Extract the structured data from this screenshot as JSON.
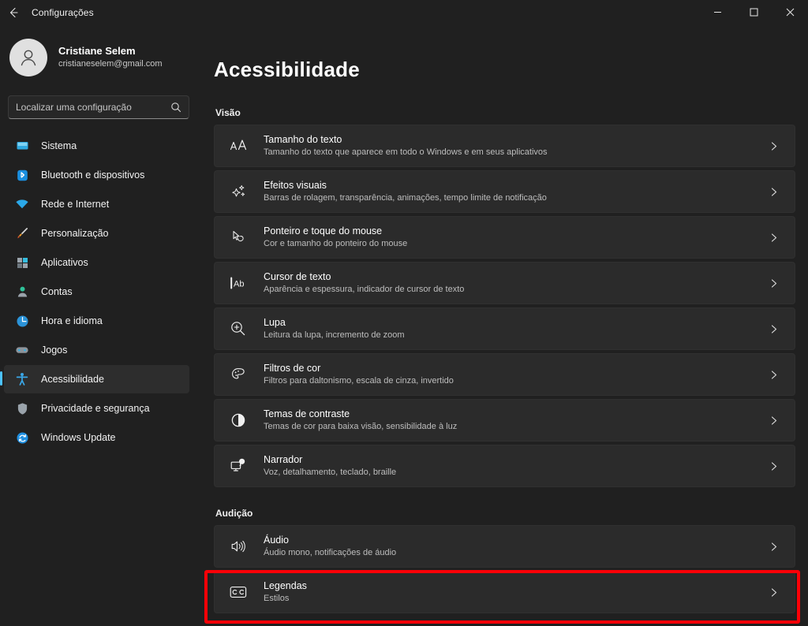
{
  "titlebar": {
    "back_icon": "back-arrow-icon",
    "title": "Configurações",
    "minimize": "–",
    "maximize": "□",
    "close": "✕"
  },
  "sidebar": {
    "account": {
      "name": "Cristiane Selem",
      "email": "cristianeselem@gmail.com",
      "avatar_icon": "person-avatar-icon"
    },
    "search": {
      "placeholder": "Localizar uma configuração",
      "value": "",
      "icon": "search-icon"
    },
    "items": [
      {
        "label": "Sistema",
        "icon": "monitor-icon",
        "active": false
      },
      {
        "label": "Bluetooth e dispositivos",
        "icon": "bluetooth-icon",
        "active": false
      },
      {
        "label": "Rede e Internet",
        "icon": "wifi-icon",
        "active": false
      },
      {
        "label": "Personalização",
        "icon": "paintbrush-icon",
        "active": false
      },
      {
        "label": "Aplicativos",
        "icon": "apps-grid-icon",
        "active": false
      },
      {
        "label": "Contas",
        "icon": "person-icon",
        "active": false
      },
      {
        "label": "Hora e idioma",
        "icon": "clock-icon",
        "active": false
      },
      {
        "label": "Jogos",
        "icon": "gamepad-icon",
        "active": false
      },
      {
        "label": "Acessibilidade",
        "icon": "accessibility-icon",
        "active": true
      },
      {
        "label": "Privacidade e segurança",
        "icon": "shield-icon",
        "active": false
      },
      {
        "label": "Windows Update",
        "icon": "update-refresh-icon",
        "active": false
      }
    ]
  },
  "main": {
    "page_title": "Acessibilidade",
    "sections": [
      {
        "heading": "Visão",
        "cards": [
          {
            "title": "Tamanho do texto",
            "subtitle": "Tamanho do texto que aparece em todo o Windows e em seus aplicativos",
            "icon": "text-size-icon",
            "chevron": "chevron-right-icon"
          },
          {
            "title": "Efeitos visuais",
            "subtitle": "Barras de rolagem, transparência, animações, tempo limite de notificação",
            "icon": "sparkle-icon",
            "chevron": "chevron-right-icon"
          },
          {
            "title": "Ponteiro e toque do mouse",
            "subtitle": "Cor e tamanho do ponteiro do mouse",
            "icon": "mouse-pointer-icon",
            "chevron": "chevron-right-icon"
          },
          {
            "title": "Cursor de texto",
            "subtitle": "Aparência e espessura, indicador de cursor de texto",
            "icon": "text-cursor-icon",
            "chevron": "chevron-right-icon"
          },
          {
            "title": "Lupa",
            "subtitle": "Leitura da lupa, incremento de zoom",
            "icon": "magnifier-plus-icon",
            "chevron": "chevron-right-icon"
          },
          {
            "title": "Filtros de cor",
            "subtitle": "Filtros para daltonismo, escala de cinza, invertido",
            "icon": "color-palette-icon",
            "chevron": "chevron-right-icon"
          },
          {
            "title": "Temas de contraste",
            "subtitle": "Temas de cor para baixa visão, sensibilidade à luz",
            "icon": "contrast-circle-icon",
            "chevron": "chevron-right-icon"
          },
          {
            "title": "Narrador",
            "subtitle": "Voz, detalhamento, teclado, braille",
            "icon": "narrator-monitor-icon",
            "chevron": "chevron-right-icon"
          }
        ]
      },
      {
        "heading": "Audição",
        "cards": [
          {
            "title": "Áudio",
            "subtitle": "Áudio mono, notificações de áudio",
            "icon": "speaker-volume-icon",
            "chevron": "chevron-right-icon"
          },
          {
            "title": "Legendas",
            "subtitle": "Estilos",
            "icon": "closed-caption-icon",
            "chevron": "chevron-right-icon",
            "highlighted": true
          }
        ]
      }
    ]
  },
  "annotation": {
    "highlight_color": "#fb0007",
    "target": "Legendas"
  },
  "colors": {
    "accent": "#4cc2ff",
    "window_bg": "#202020",
    "card_bg": "#2b2b2b",
    "highlight": "#fb0007"
  }
}
